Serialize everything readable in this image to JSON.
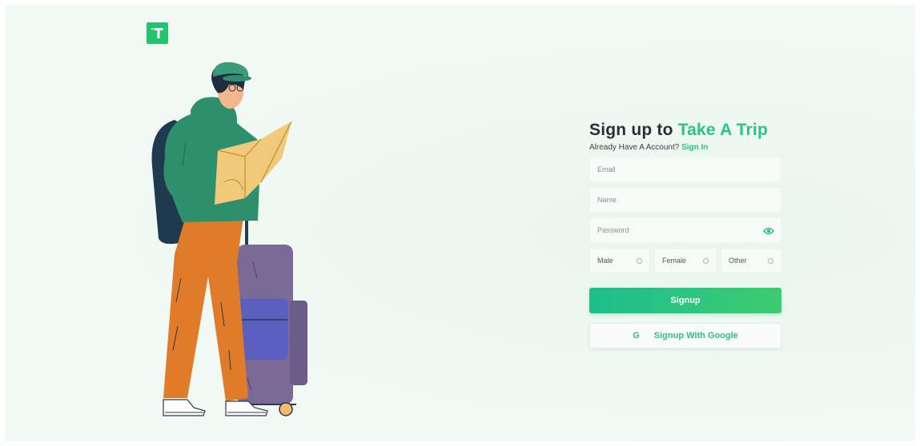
{
  "brand": {
    "logo_letter": "T",
    "accent_color": "#2cc383",
    "logo_color": "#22c46e"
  },
  "form": {
    "title_prefix": "Sign up to",
    "title_accent": "Take A Trip",
    "subtitle": "Already Have A Account?",
    "signin_link": "Sign In",
    "email_placeholder": "Email",
    "name_placeholder": "Name",
    "password_placeholder": "Password",
    "password_toggle_icon": "eye-icon",
    "gender_options": [
      "Male",
      "Female",
      "Other"
    ],
    "signup_label": "Signup",
    "google_icon_letter": "G",
    "google_label": "Signup With Google"
  }
}
